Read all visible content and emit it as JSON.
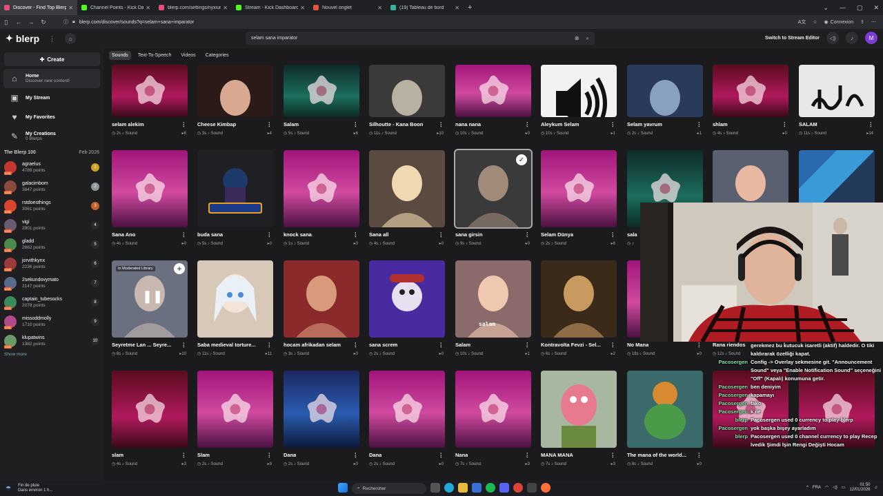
{
  "browser": {
    "tabs": [
      {
        "label": "Discover - Find Top Blerp",
        "active": true,
        "color": "#e64d7a"
      },
      {
        "label": "Channel Points - Kick Dashboard",
        "active": false,
        "color": "#53fc18"
      },
      {
        "label": "blerp.com/settings/nyxiumer?s",
        "active": false,
        "color": "#e64d7a"
      },
      {
        "label": "Stream - Kick Dashboard",
        "active": false,
        "color": "#53fc18"
      },
      {
        "label": "Nouvel onglet",
        "active": false,
        "color": "#e3553a"
      },
      {
        "label": "(19) Tableau de bord",
        "active": false,
        "color": "#3ab0a0"
      }
    ],
    "new_tab": "+",
    "url": "blerp.com/discover/sounds?q=selam+sana+imparator",
    "connexion": "Connexion"
  },
  "app": {
    "logo": "blerp",
    "search_value": "selam sana imparator",
    "switch_editor": "Switch to Stream Editor",
    "avatar_letter": "M"
  },
  "sidebar": {
    "create": "Create",
    "nav": [
      {
        "label": "Home",
        "sub": "Discover new content!",
        "icon": "home-icon",
        "glyph": "⌂"
      },
      {
        "label": "My Stream",
        "sub": "",
        "icon": "stream-icon",
        "glyph": "▣"
      },
      {
        "label": "My Favorites",
        "sub": "",
        "icon": "heart-icon",
        "glyph": "♥"
      },
      {
        "label": "My Creations",
        "sub": "0 Blerps",
        "icon": "wrench-icon",
        "glyph": "✎"
      }
    ],
    "top100_title": "The Blerp 100",
    "top100_date": "Feb 2026",
    "leaders": [
      {
        "name": "agraelus",
        "points": "4789 points",
        "rank": "1",
        "color": "#c9a227",
        "avatar": "#c2372f"
      },
      {
        "name": "galacimbom",
        "points": "3847 points",
        "rank": "2",
        "color": "#8f9499",
        "avatar": "#8a4b3c"
      },
      {
        "name": "rstdoesthings",
        "points": "3061 points",
        "rank": "3",
        "color": "#c0602a",
        "avatar": "#d8452e"
      },
      {
        "name": "vigi",
        "points": "2901 points",
        "rank": "4",
        "color": "#2a2a2e",
        "avatar": "#6a5a70"
      },
      {
        "name": "gladd",
        "points": "2662 points",
        "rank": "5",
        "color": "#2a2a2e",
        "avatar": "#4a8a4a"
      },
      {
        "name": "jorvithkynx",
        "points": "2236 points",
        "rank": "6",
        "color": "#2a2a2e",
        "avatar": "#9a3a3a"
      },
      {
        "name": "2sekundovymato",
        "points": "2147 points",
        "rank": "7",
        "color": "#2a2a2e",
        "avatar": "#5a6a8a"
      },
      {
        "name": "captain_tubesocks",
        "points": "2078 points",
        "rank": "8",
        "color": "#2a2a2e",
        "avatar": "#3a8a5a"
      },
      {
        "name": "missoddmolly",
        "points": "1710 points",
        "rank": "9",
        "color": "#2a2a2e",
        "avatar": "#b04a8a"
      },
      {
        "name": "klupatwins",
        "points": "1382 points",
        "rank": "10",
        "color": "#2a2a2e",
        "avatar": "#6a9a6a"
      }
    ],
    "show_more": "Show more"
  },
  "chips": [
    "Sounds",
    "Text-To-Speech",
    "Videos",
    "Categories"
  ],
  "cards": [
    {
      "title": "selam alekim",
      "dur": "2s",
      "type": "Sound",
      "count": "6",
      "style": "star"
    },
    {
      "title": "Cheese Kimbap",
      "dur": "3s",
      "type": "Sound",
      "count": "4",
      "style": "photo1"
    },
    {
      "title": "Salam",
      "dur": "5s",
      "type": "Sound",
      "count": "6",
      "style": "star2"
    },
    {
      "title": "Silhoutte - Kana Boon",
      "dur": "11s",
      "type": "Sound",
      "count": "10",
      "style": "photo2"
    },
    {
      "title": "nana nana",
      "dur": "10s",
      "type": "Sound",
      "count": "0",
      "style": "star3"
    },
    {
      "title": "Aleykum Selam",
      "dur": "10s",
      "type": "Sound",
      "count": "1",
      "style": "speaker"
    },
    {
      "title": "Selam yavrum",
      "dur": "2s",
      "type": "Sound",
      "count": "1",
      "style": "photo3"
    },
    {
      "title": "shlam",
      "dur": "4s",
      "type": "Sound",
      "count": "0",
      "style": "star"
    },
    {
      "title": "SALAM",
      "dur": "11s",
      "type": "Sound",
      "count": "14",
      "style": "arabic"
    },
    {
      "title": "Sana Ano",
      "dur": "4s",
      "type": "Sound",
      "count": "0",
      "style": "star3"
    },
    {
      "title": "buda sana",
      "dur": "5s",
      "type": "Sound",
      "count": "0",
      "style": "gamezone"
    },
    {
      "title": "knock sana",
      "dur": "1s",
      "type": "Sound",
      "count": "0",
      "style": "star3"
    },
    {
      "title": "Sana all",
      "dur": "4s",
      "type": "Sound",
      "count": "0",
      "style": "photo4"
    },
    {
      "title": "sana girsin",
      "dur": "9s",
      "type": "Sound",
      "count": "0",
      "style": "photo5"
    },
    {
      "title": "Selam Dünya",
      "dur": "2s",
      "type": "Sound",
      "count": "6",
      "style": "star3"
    },
    {
      "title": "sala",
      "dur": "",
      "type": "",
      "count": "",
      "style": "star2"
    },
    {
      "title": "",
      "dur": "",
      "type": "",
      "count": "",
      "style": "photo6"
    },
    {
      "title": "",
      "dur": "",
      "type": "",
      "count": "",
      "style": "kotlin"
    },
    {
      "title": "Seyretme Lan ... Seyre...",
      "dur": "6s",
      "type": "Sound",
      "count": "10",
      "style": "photo7",
      "badge": "In Moderated Library"
    },
    {
      "title": "Saba medieval torture...",
      "dur": "11s",
      "type": "Sound",
      "count": "11",
      "style": "anime"
    },
    {
      "title": "hocam afrikadan selam",
      "dur": "3s",
      "type": "Sound",
      "count": "0",
      "style": "photo8"
    },
    {
      "title": "sana screm",
      "dur": "2s",
      "type": "Sound",
      "count": "0",
      "style": "purple"
    },
    {
      "title": "Salam",
      "dur": "10s",
      "type": "Sound",
      "count": "1",
      "style": "photo9",
      "caption": "salam"
    },
    {
      "title": "Kontravolta Fevzi - Sel...",
      "dur": "6s",
      "type": "Sound",
      "count": "2",
      "style": "photo10"
    },
    {
      "title": "No Mana",
      "dur": "18s",
      "type": "Sound",
      "count": "0",
      "style": "star3"
    },
    {
      "title": "Rana riendos",
      "dur": "12s",
      "type": "Sound",
      "count": "",
      "style": "star"
    },
    {
      "title": "",
      "dur": "",
      "type": "",
      "count": "",
      "style": "blank"
    },
    {
      "title": "slam",
      "dur": "4s",
      "type": "Sound",
      "count": "3",
      "style": "star"
    },
    {
      "title": "Slam",
      "dur": "2s",
      "type": "Sound",
      "count": "9",
      "style": "star3"
    },
    {
      "title": "Dana",
      "dur": "2s",
      "type": "Sound",
      "count": "0",
      "style": "star4"
    },
    {
      "title": "Dana",
      "dur": "2s",
      "type": "Sound",
      "count": "0",
      "style": "star3"
    },
    {
      "title": "Nana",
      "dur": "7s",
      "type": "Sound",
      "count": "3",
      "style": "star3"
    },
    {
      "title": "MANA MANA",
      "dur": "7s",
      "type": "Sound",
      "count": "3",
      "style": "muppet"
    },
    {
      "title": "The mana of the world...",
      "dur": "8s",
      "type": "Sound",
      "count": "0",
      "style": "game"
    },
    {
      "title": "",
      "dur": "",
      "type": "",
      "count": "",
      "style": "star"
    },
    {
      "title": "",
      "dur": "",
      "type": "",
      "count": "",
      "style": "star"
    }
  ],
  "chat": {
    "lines": [
      {
        "user": "",
        "text": "gerekmez bu kutucuk isaretli (aktif) haldedir. O tiki kaldırarak özelliği kapat."
      },
      {
        "user": "Pacosergen",
        "text": "Config -> Overlay sekmesine git. \"Announcement Sound\" veya \"Enable Notification Sound\" seçeneğini \"Off\" (Kapalı) konumuna getir."
      },
      {
        "user": "Pacosergen",
        "text": "ben deniyim"
      },
      {
        "user": "Pacosergen",
        "text": "kapamayı"
      },
      {
        "user": "Pacosergen",
        "text": "fako"
      },
      {
        "user": "Pacosergen",
        "text": "k ile"
      },
      {
        "user": "blerp",
        "text": "Pacosergen used 0 currency to play blerp"
      },
      {
        "user": "Pacosergen",
        "text": "yok başka bişey ayarladım"
      },
      {
        "user": "blerp",
        "text": "Pacosergen used 0 channel currency to play Recep İvedik Şimdi İşin Rengi Değişti Hocam"
      }
    ]
  },
  "taskbar": {
    "weather_title": "Fin de pluie",
    "weather_sub": "Dans environ 1 h...",
    "search": "Rechercher",
    "time": "01:50",
    "date": "12/01/2026",
    "lang": "FRA"
  }
}
